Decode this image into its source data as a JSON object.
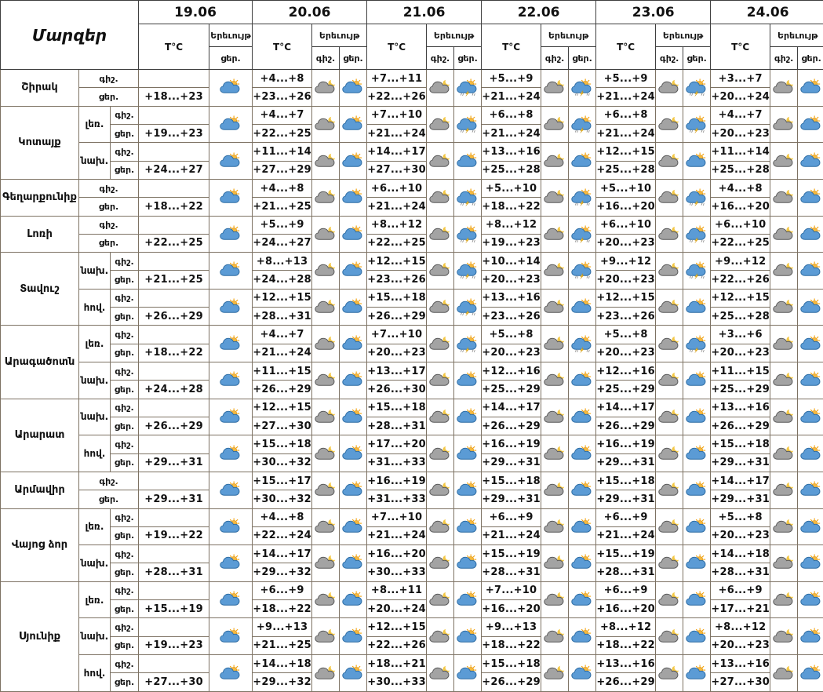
{
  "title": "Մարզեր",
  "dates": [
    "19.06",
    "20.06",
    "21.06",
    "22.06",
    "23.06",
    "24.06"
  ],
  "labels": {
    "temp": "T°C",
    "phenomenon": "Երեւույթ",
    "night": "գիշ.",
    "day": "ցեր."
  },
  "icons": {
    "sun": {
      "name": "sun-behind-cloud"
    },
    "moon": {
      "name": "moon-behind-cloud"
    },
    "storm": {
      "name": "thunderstorm-rain"
    }
  },
  "colors": {
    "body_border": "#7d7263",
    "header_border": "#3f3f3f",
    "day_cloud": "#5b9bd5",
    "night_cloud": "#a3a3a3",
    "sun": "#f6b93d",
    "moon": "#f3c744",
    "lightning": "#f6c73d"
  },
  "regions": [
    {
      "name": "Շիրակ",
      "zones": [
        {
          "zone": "",
          "days": [
            [
              "",
              "+18...+23",
              "",
              "sun"
            ],
            [
              "+4...+8",
              "+23...+26",
              "moon",
              "sun"
            ],
            [
              "+7...+11",
              "+22...+26",
              "moon",
              "storm"
            ],
            [
              "+5...+9",
              "+21...+24",
              "moon",
              "storm"
            ],
            [
              "+5...+9",
              "+21...+24",
              "moon",
              "storm"
            ],
            [
              "+3...+7",
              "+20...+24",
              "moon",
              "sun"
            ]
          ]
        }
      ]
    },
    {
      "name": "Կոտայք",
      "zones": [
        {
          "zone": "լեռ.",
          "days": [
            [
              "",
              "+19...+23",
              "",
              "sun"
            ],
            [
              "+4...+7",
              "+22...+25",
              "moon",
              "sun"
            ],
            [
              "+7...+10",
              "+21...+24",
              "moon",
              "storm"
            ],
            [
              "+6...+8",
              "+21...+24",
              "moon",
              "storm"
            ],
            [
              "+6...+8",
              "+21...+24",
              "moon",
              "storm"
            ],
            [
              "+4...+7",
              "+20...+23",
              "moon",
              "sun"
            ]
          ]
        },
        {
          "zone": "նախ.",
          "days": [
            [
              "",
              "+24...+27",
              "",
              "sun"
            ],
            [
              "+11...+14",
              "+27...+29",
              "moon",
              "sun"
            ],
            [
              "+14...+17",
              "+27...+30",
              "moon",
              "sun"
            ],
            [
              "+13...+16",
              "+25...+28",
              "moon",
              "sun"
            ],
            [
              "+12...+15",
              "+25...+28",
              "moon",
              "sun"
            ],
            [
              "+11...+14",
              "+25...+28",
              "moon",
              "sun"
            ]
          ]
        }
      ]
    },
    {
      "name": "Գեղարքունիք",
      "zones": [
        {
          "zone": "",
          "days": [
            [
              "",
              "+18...+22",
              "",
              "sun"
            ],
            [
              "+4...+8",
              "+21...+25",
              "moon",
              "sun"
            ],
            [
              "+6...+10",
              "+21...+24",
              "moon",
              "storm"
            ],
            [
              "+5...+10",
              "+18...+22",
              "moon",
              "storm"
            ],
            [
              "+5...+10",
              "+16...+20",
              "moon",
              "storm"
            ],
            [
              "+4...+8",
              "+16...+20",
              "moon",
              "sun"
            ]
          ]
        }
      ]
    },
    {
      "name": "Լոռի",
      "zones": [
        {
          "zone": "",
          "days": [
            [
              "",
              "+22...+25",
              "",
              "sun"
            ],
            [
              "+5...+9",
              "+24...+27",
              "moon",
              "sun"
            ],
            [
              "+8...+12",
              "+22...+25",
              "moon",
              "storm"
            ],
            [
              "+8...+12",
              "+19...+23",
              "moon",
              "storm"
            ],
            [
              "+6...+10",
              "+20...+23",
              "moon",
              "storm"
            ],
            [
              "+6...+10",
              "+22...+25",
              "moon",
              "sun"
            ]
          ]
        }
      ]
    },
    {
      "name": "Տավուշ",
      "zones": [
        {
          "zone": "նախ.",
          "days": [
            [
              "",
              "+21...+25",
              "",
              "sun"
            ],
            [
              "+8...+13",
              "+24...+28",
              "moon",
              "sun"
            ],
            [
              "+12...+15",
              "+23...+26",
              "moon",
              "storm"
            ],
            [
              "+10...+14",
              "+20...+23",
              "moon",
              "storm"
            ],
            [
              "+9...+12",
              "+20...+23",
              "moon",
              "storm"
            ],
            [
              "+9...+12",
              "+22...+26",
              "moon",
              "sun"
            ]
          ]
        },
        {
          "zone": "հով.",
          "days": [
            [
              "",
              "+26...+29",
              "",
              "sun"
            ],
            [
              "+12...+15",
              "+28...+31",
              "moon",
              "sun"
            ],
            [
              "+15...+18",
              "+26...+29",
              "moon",
              "storm"
            ],
            [
              "+13...+16",
              "+23...+26",
              "moon",
              "sun"
            ],
            [
              "+12...+15",
              "+23...+26",
              "moon",
              "sun"
            ],
            [
              "+12...+15",
              "+25...+28",
              "moon",
              "sun"
            ]
          ]
        }
      ]
    },
    {
      "name": "Արագածոտն",
      "zones": [
        {
          "zone": "լեռ.",
          "days": [
            [
              "",
              "+18...+22",
              "",
              "sun"
            ],
            [
              "+4...+7",
              "+21...+24",
              "moon",
              "sun"
            ],
            [
              "+7...+10",
              "+20...+23",
              "moon",
              "storm"
            ],
            [
              "+5...+8",
              "+20...+23",
              "moon",
              "storm"
            ],
            [
              "+5...+8",
              "+20...+23",
              "moon",
              "storm"
            ],
            [
              "+3...+6",
              "+20...+23",
              "moon",
              "sun"
            ]
          ]
        },
        {
          "zone": "նախ.",
          "days": [
            [
              "",
              "+24...+28",
              "",
              "sun"
            ],
            [
              "+11...+15",
              "+26...+29",
              "moon",
              "sun"
            ],
            [
              "+13...+17",
              "+26...+30",
              "moon",
              "sun"
            ],
            [
              "+12...+16",
              "+25...+29",
              "moon",
              "sun"
            ],
            [
              "+12...+16",
              "+25...+29",
              "moon",
              "sun"
            ],
            [
              "+11...+15",
              "+25...+29",
              "moon",
              "sun"
            ]
          ]
        }
      ]
    },
    {
      "name": "Արարատ",
      "zones": [
        {
          "zone": "նախ.",
          "days": [
            [
              "",
              "+26...+29",
              "",
              "sun"
            ],
            [
              "+12...+15",
              "+27...+30",
              "moon",
              "sun"
            ],
            [
              "+15...+18",
              "+28...+31",
              "moon",
              "sun"
            ],
            [
              "+14...+17",
              "+26...+29",
              "moon",
              "sun"
            ],
            [
              "+14...+17",
              "+26...+29",
              "moon",
              "sun"
            ],
            [
              "+13...+16",
              "+26...+29",
              "moon",
              "sun"
            ]
          ]
        },
        {
          "zone": "հով.",
          "days": [
            [
              "",
              "+29...+31",
              "",
              "sun"
            ],
            [
              "+15...+18",
              "+30...+32",
              "moon",
              "sun"
            ],
            [
              "+17...+20",
              "+31...+33",
              "moon",
              "sun"
            ],
            [
              "+16...+19",
              "+29...+31",
              "moon",
              "sun"
            ],
            [
              "+16...+19",
              "+29...+31",
              "moon",
              "sun"
            ],
            [
              "+15...+18",
              "+29...+31",
              "moon",
              "sun"
            ]
          ]
        }
      ]
    },
    {
      "name": "Արմավիր",
      "zones": [
        {
          "zone": "",
          "days": [
            [
              "",
              "+29...+31",
              "",
              "sun"
            ],
            [
              "+15...+17",
              "+30...+32",
              "moon",
              "sun"
            ],
            [
              "+16...+19",
              "+31...+33",
              "moon",
              "sun"
            ],
            [
              "+15...+18",
              "+29...+31",
              "moon",
              "sun"
            ],
            [
              "+15...+18",
              "+29...+31",
              "moon",
              "sun"
            ],
            [
              "+14...+17",
              "+29...+31",
              "moon",
              "sun"
            ]
          ]
        }
      ]
    },
    {
      "name": "Վայոց ձոր",
      "zones": [
        {
          "zone": "լեռ.",
          "days": [
            [
              "",
              "+19...+22",
              "",
              "sun"
            ],
            [
              "+4...+8",
              "+22...+24",
              "moon",
              "sun"
            ],
            [
              "+7...+10",
              "+21...+24",
              "moon",
              "sun"
            ],
            [
              "+6...+9",
              "+21...+24",
              "moon",
              "sun"
            ],
            [
              "+6...+9",
              "+21...+24",
              "moon",
              "sun"
            ],
            [
              "+5...+8",
              "+20...+23",
              "moon",
              "sun"
            ]
          ]
        },
        {
          "zone": "նախ.",
          "days": [
            [
              "",
              "+28...+31",
              "",
              "sun"
            ],
            [
              "+14...+17",
              "+29...+32",
              "moon",
              "sun"
            ],
            [
              "+16...+20",
              "+30...+33",
              "moon",
              "sun"
            ],
            [
              "+15...+19",
              "+28...+31",
              "moon",
              "sun"
            ],
            [
              "+15...+19",
              "+28...+31",
              "moon",
              "sun"
            ],
            [
              "+14...+18",
              "+28...+31",
              "moon",
              "sun"
            ]
          ]
        }
      ]
    },
    {
      "name": "Սյունիք",
      "zones": [
        {
          "zone": "լեռ.",
          "days": [
            [
              "",
              "+15...+19",
              "",
              "sun"
            ],
            [
              "+6...+9",
              "+18...+22",
              "moon",
              "sun"
            ],
            [
              "+8...+11",
              "+20...+24",
              "moon",
              "sun"
            ],
            [
              "+7...+10",
              "+16...+20",
              "moon",
              "sun"
            ],
            [
              "+6...+9",
              "+16...+20",
              "moon",
              "sun"
            ],
            [
              "+6...+9",
              "+17...+21",
              "moon",
              "sun"
            ]
          ]
        },
        {
          "zone": "նախ.",
          "days": [
            [
              "",
              "+19...+23",
              "",
              "sun"
            ],
            [
              "+9...+13",
              "+21...+25",
              "moon",
              "sun"
            ],
            [
              "+12...+15",
              "+22...+26",
              "moon",
              "sun"
            ],
            [
              "+9...+13",
              "+18...+22",
              "moon",
              "sun"
            ],
            [
              "+8...+12",
              "+18...+22",
              "moon",
              "sun"
            ],
            [
              "+8...+12",
              "+20...+23",
              "moon",
              "sun"
            ]
          ]
        },
        {
          "zone": "հով.",
          "days": [
            [
              "",
              "+27...+30",
              "",
              "sun"
            ],
            [
              "+14...+18",
              "+29...+32",
              "moon",
              "sun"
            ],
            [
              "+18...+21",
              "+30...+33",
              "moon",
              "sun"
            ],
            [
              "+15...+18",
              "+26...+29",
              "moon",
              "sun"
            ],
            [
              "+13...+16",
              "+26...+29",
              "moon",
              "sun"
            ],
            [
              "+13...+16",
              "+27...+30",
              "moon",
              "sun"
            ]
          ]
        }
      ]
    }
  ]
}
